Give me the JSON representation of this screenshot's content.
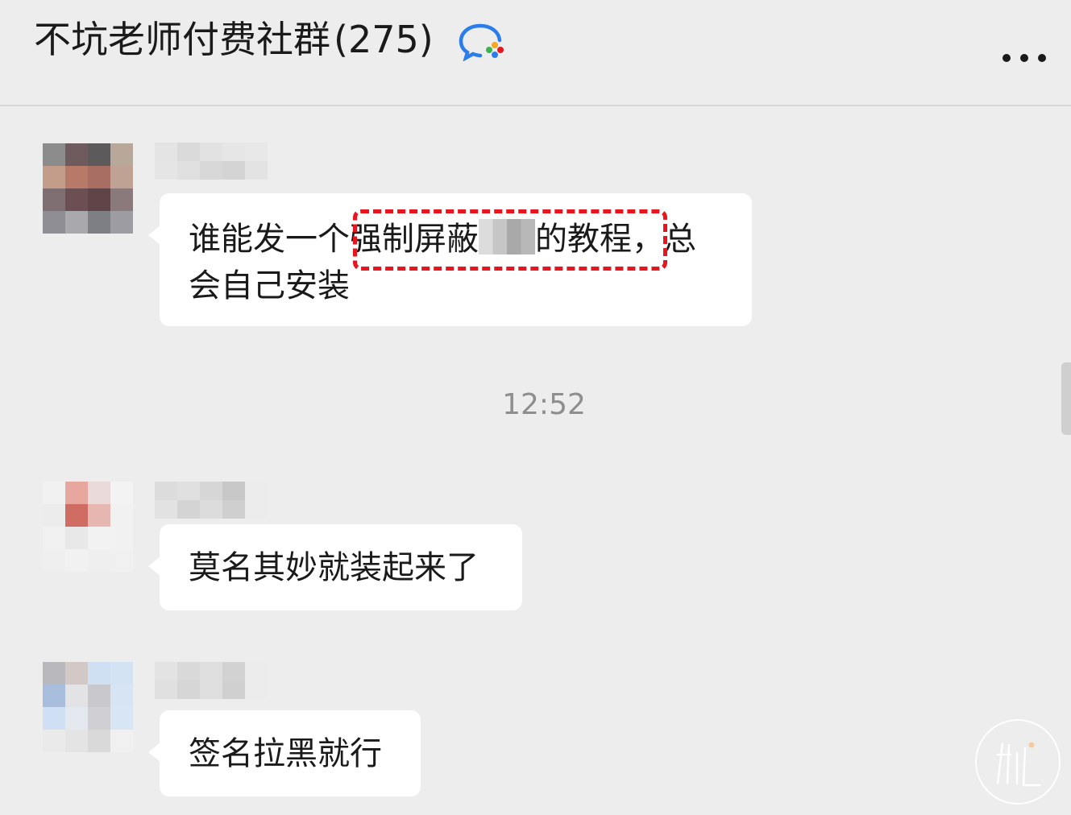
{
  "header": {
    "title": "不坑老师付费社群",
    "member_count": "(275)",
    "logo_icon": "chat-bubble-logo-icon",
    "more_icon": "more-dots-icon"
  },
  "messages": [
    {
      "text_before": "谁能发一个",
      "highlighted_before_redact": "强制屏蔽",
      "highlighted_after_redact": "的教程",
      "text_after": "，总会自己安装",
      "redacted": true
    },
    {
      "text": "莫名其妙就装起来了"
    },
    {
      "text": "签名拉黑就行"
    }
  ],
  "timestamp": "12:52",
  "colors": {
    "background": "#ededed",
    "bubble": "#ffffff",
    "highlight": "#e8141e",
    "timestamp": "#8e8e8e"
  }
}
